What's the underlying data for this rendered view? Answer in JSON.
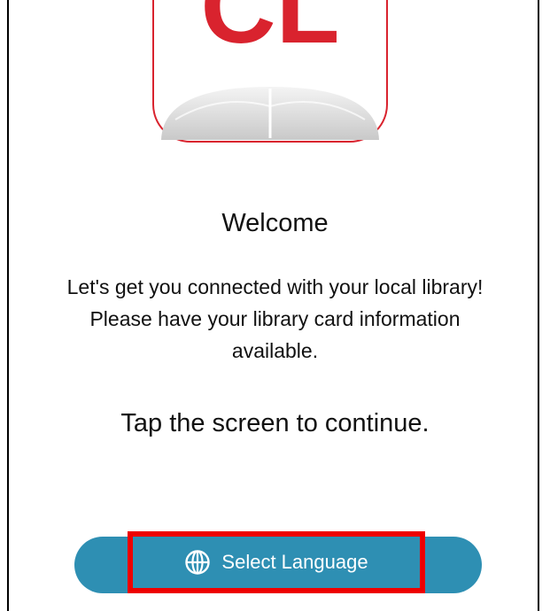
{
  "logo": {
    "text": "CL",
    "brand_color": "#d9232e",
    "icon": "book-logo-icon"
  },
  "welcome": {
    "title": "Welcome",
    "message": "Let's get you connected with your local library! Please have your library card information available.",
    "tap_hint": "Tap the screen to continue."
  },
  "language_button": {
    "label": "Select Language",
    "icon": "globe-icon",
    "bg_color": "#2e8fb3",
    "highlight_color": "#ee0000"
  }
}
